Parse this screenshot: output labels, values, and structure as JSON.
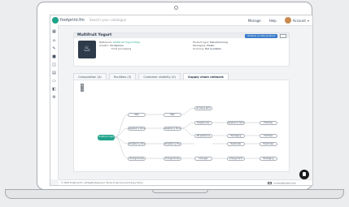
{
  "header": {
    "brand": "footprint.fm",
    "search_placeholder": "Search your catalogue",
    "manage": "Manage",
    "help": "Help",
    "account": "Account"
  },
  "sidebar": {
    "items": [
      {
        "icon": "grid-icon"
      },
      {
        "icon": "home-icon"
      },
      {
        "icon": "leaf-icon"
      },
      {
        "icon": "box-icon"
      },
      {
        "icon": "cart-icon"
      },
      {
        "icon": "chart-icon"
      },
      {
        "icon": "document-icon"
      },
      {
        "icon": "flask-icon"
      },
      {
        "icon": "settings-icon"
      }
    ]
  },
  "product": {
    "title": "Multifruit Yogurt",
    "primary_button": "Actions on the product",
    "more_button": "…",
    "reference_label": "Reference:",
    "reference_value": "Multifruit Yogurt 500g",
    "creator_label": "Creator:",
    "creator_value": "Prodsphere",
    "category_value": "Food processing",
    "product_label": "Product type:",
    "product_value": "Manufacturing",
    "packaging_label": "Packaging:",
    "packaging_value": "Plastic",
    "origin_label": "Sourcing:",
    "origin_value": "Not available"
  },
  "tabs": [
    {
      "label": "Composition (4)"
    },
    {
      "label": "Facilities (3)"
    },
    {
      "label": "Customer visibility (0)"
    },
    {
      "label": "Supply chain network"
    }
  ],
  "graph": {
    "root": "Multifruit Yogurt",
    "nodes": [
      {
        "label": "Milk"
      },
      {
        "label": "Milk"
      },
      {
        "label": "Raspberry Puree"
      },
      {
        "label": "Raspberry Puree"
      },
      {
        "label": "Strawberry Puree"
      },
      {
        "label": "Strawberry Puree"
      },
      {
        "label": "Orange Puree"
      },
      {
        "label": "Orange Puree"
      },
      {
        "label": "Growing farm"
      },
      {
        "label": "Raspberries"
      },
      {
        "label": "Raspberry farm"
      },
      {
        "label": "Strawberries"
      },
      {
        "label": "Oranges"
      },
      {
        "label": "Orange farm"
      },
      {
        "label": "Fertilizer"
      },
      {
        "label": "Fertilizer"
      },
      {
        "label": "Pesticides"
      },
      {
        "label": "Pesticides"
      },
      {
        "label": "Packaging"
      },
      {
        "label": "Packaging"
      }
    ]
  },
  "footer": {
    "copyright": "© 2024 Footprint.fm. All Rights Reserved. Terms of Service and Privacy Policy",
    "contact": "contact@footprint.fm"
  },
  "colors": {
    "accent": "#1fa38a",
    "primary_button": "#3c7dc8",
    "text": "#2c3a4d"
  }
}
